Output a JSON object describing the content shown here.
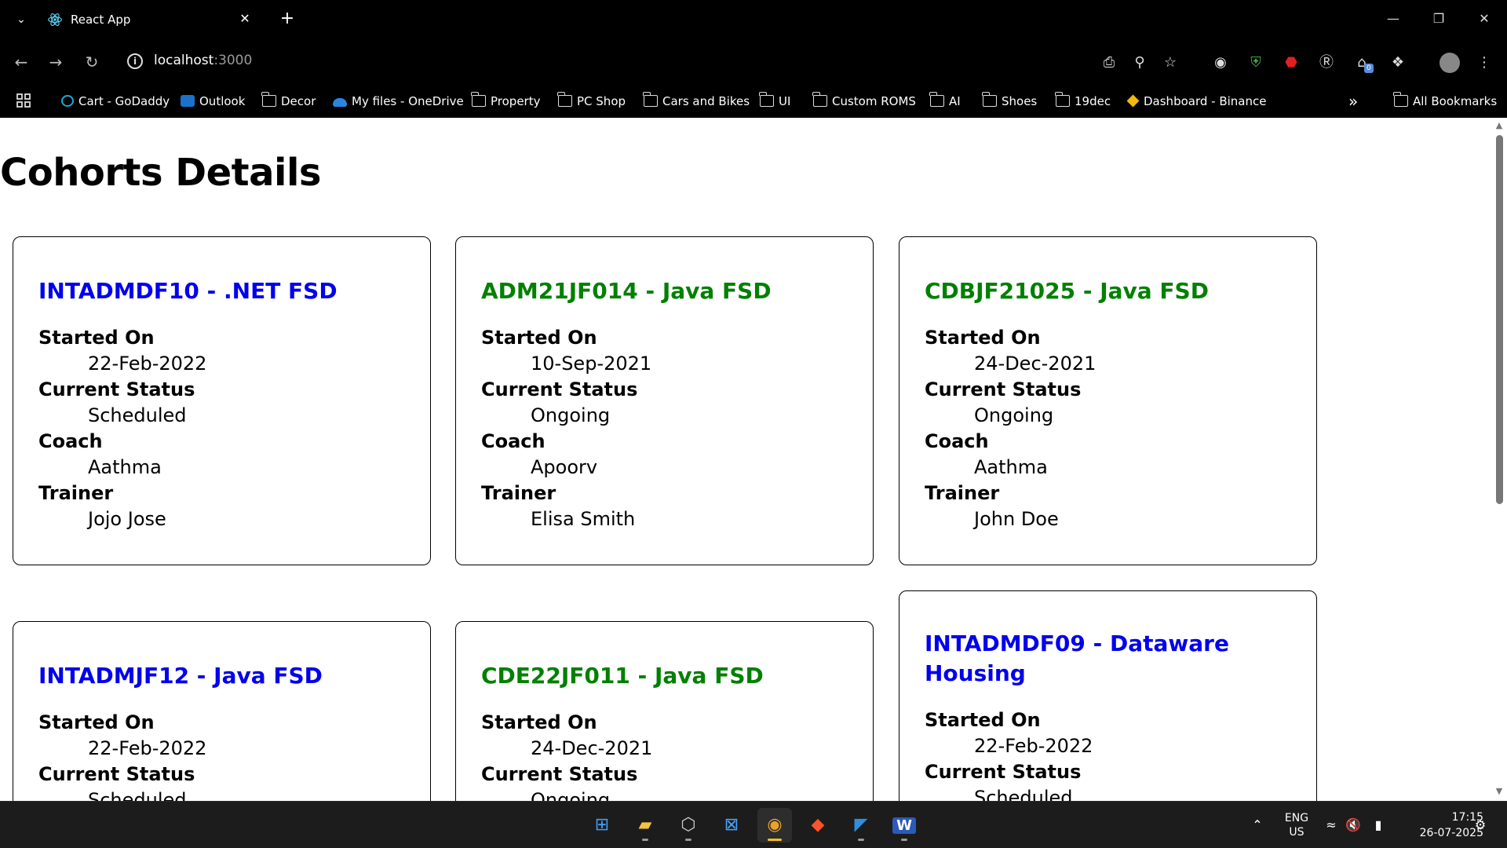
{
  "browser": {
    "tab_title": "React App",
    "tab_close": "✕",
    "new_tab": "+",
    "url_host": "localhost",
    "url_port": ":3000",
    "window_controls": {
      "minimize": "—",
      "restore": "❐",
      "close": "✕"
    }
  },
  "bookmarks": [
    {
      "label": "Cart - GoDaddy",
      "icon": "godaddy-icon"
    },
    {
      "label": "Outlook",
      "icon": "outlook-icon"
    },
    {
      "label": "Decor",
      "icon": "folder-icon"
    },
    {
      "label": "My files - OneDrive",
      "icon": "onedrive-icon"
    },
    {
      "label": "Property",
      "icon": "folder-icon"
    },
    {
      "label": "PC Shop",
      "icon": "folder-icon"
    },
    {
      "label": "Cars and Bikes",
      "icon": "folder-icon"
    },
    {
      "label": "UI",
      "icon": "folder-icon"
    },
    {
      "label": "Custom ROMS",
      "icon": "folder-icon"
    },
    {
      "label": "AI",
      "icon": "folder-icon"
    },
    {
      "label": "Shoes",
      "icon": "folder-icon"
    },
    {
      "label": "19dec",
      "icon": "folder-icon"
    },
    {
      "label": "Dashboard - Binance",
      "icon": "binance-icon"
    }
  ],
  "bookmarks_overflow": "»",
  "all_bookmarks": "All Bookmarks",
  "extension_badge": "0",
  "page": {
    "title": "Cohorts Details",
    "cohorts": [
      {
        "name": "INTADMDF10 - .NET FSD",
        "status_color": "#0000ee",
        "started_label": "Started On",
        "started": "22-Feb-2022",
        "status_label": "Current Status",
        "status": "Scheduled",
        "coach_label": "Coach",
        "coach": "Aathma",
        "trainer_label": "Trainer",
        "trainer": "Jojo Jose"
      },
      {
        "name": "ADM21JF014 - Java FSD",
        "status_color": "#008000",
        "started_label": "Started On",
        "started": "10-Sep-2021",
        "status_label": "Current Status",
        "status": "Ongoing",
        "coach_label": "Coach",
        "coach": "Apoorv",
        "trainer_label": "Trainer",
        "trainer": "Elisa Smith"
      },
      {
        "name": "CDBJF21025 - Java FSD",
        "status_color": "#008000",
        "started_label": "Started On",
        "started": "24-Dec-2021",
        "status_label": "Current Status",
        "status": "Ongoing",
        "coach_label": "Coach",
        "coach": "Aathma",
        "trainer_label": "Trainer",
        "trainer": "John Doe"
      },
      {
        "name": "INTADMJF12 - Java FSD",
        "status_color": "#0000ee",
        "started_label": "Started On",
        "started": "22-Feb-2022",
        "status_label": "Current Status",
        "status": "Scheduled"
      },
      {
        "name": "CDE22JF011 - Java FSD",
        "status_color": "#008000",
        "started_label": "Started On",
        "started": "24-Dec-2021",
        "status_label": "Current Status",
        "status": "Ongoing"
      },
      {
        "name": "INTADMDF09 - Dataware Housing",
        "status_color": "#0000ee",
        "started_label": "Started On",
        "started": "22-Feb-2022",
        "status_label": "Current Status",
        "status": "Scheduled"
      }
    ]
  },
  "taskbar": {
    "apps": [
      "windows-start-icon",
      "file-explorer-icon",
      "unity-icon",
      "microsoft-store-icon",
      "chrome-icon",
      "brave-icon",
      "vscode-icon",
      "word-icon"
    ],
    "lang_1": "ENG",
    "lang_2": "US",
    "time": "17:15",
    "date": "26-07-2025"
  }
}
